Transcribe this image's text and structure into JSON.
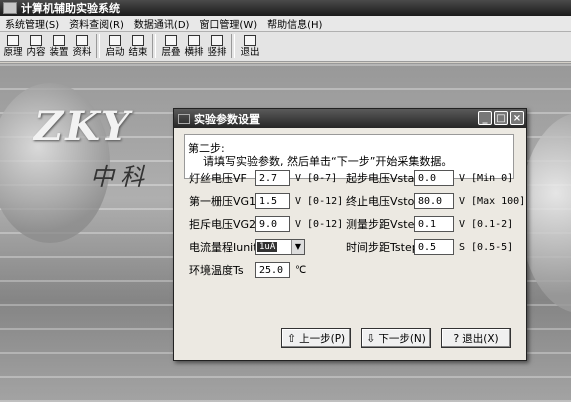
{
  "app": {
    "title": "计算机辅助实验系统"
  },
  "menu": [
    "系统管理(S)",
    "资料查阅(R)",
    "数据通讯(D)",
    "窗口管理(W)",
    "帮助信息(H)"
  ],
  "toolbar": {
    "groups": [
      [
        {
          "label": "原理",
          "icon": "principle-icon"
        },
        {
          "label": "内容",
          "icon": "content-icon"
        },
        {
          "label": "装置",
          "icon": "device-icon"
        },
        {
          "label": "资料",
          "icon": "docs-icon"
        }
      ],
      [
        {
          "label": "启动",
          "icon": "start-icon"
        },
        {
          "label": "结束",
          "icon": "stop-icon"
        }
      ],
      [
        {
          "label": "层叠",
          "icon": "cascade-icon"
        },
        {
          "label": "横排",
          "icon": "tile-horizontal-icon"
        },
        {
          "label": "竖排",
          "icon": "tile-vertical-icon"
        }
      ],
      [
        {
          "label": "退出",
          "icon": "exit-icon"
        }
      ]
    ]
  },
  "background": {
    "logo": "ZKY",
    "logo_cn": "中科"
  },
  "dialog": {
    "title": "实验参数设置",
    "info": {
      "step": "第二步:",
      "text": "请填写实验参数, 然后单击“下一步”开始采集数据。"
    },
    "left_fields": [
      {
        "label": "灯丝电压VF",
        "value": "2.7",
        "unit": "V [0-7]"
      },
      {
        "label": "第一栅压VG1K",
        "value": "1.5",
        "unit": "V [0-12]"
      },
      {
        "label": "拒斥电压VG2A",
        "value": "9.0",
        "unit": "V [0-12]"
      }
    ],
    "right_fields": [
      {
        "label": "起步电压Vstart",
        "value": "0.0",
        "unit": "V [Min 0]"
      },
      {
        "label": "终止电压Vstop",
        "value": "80.0",
        "unit": "V [Max 100]"
      },
      {
        "label": "测量步距Vstep",
        "value": "0.1",
        "unit": "V [0.1-2]"
      },
      {
        "label": "时间步距Tstep",
        "value": "0.5",
        "unit": "S [0.5-5]"
      }
    ],
    "current_range": {
      "label": "电流量程Iunit",
      "value": "1uA"
    },
    "temperature": {
      "label": "环境温度Ts",
      "value": "25.0",
      "unit": "℃"
    },
    "buttons": {
      "prev": "上一步(P)",
      "next": "下一步(N)",
      "exit": "退出(X)"
    },
    "window_controls": {
      "minimize": "_",
      "maximize": "□",
      "close": "×"
    }
  }
}
